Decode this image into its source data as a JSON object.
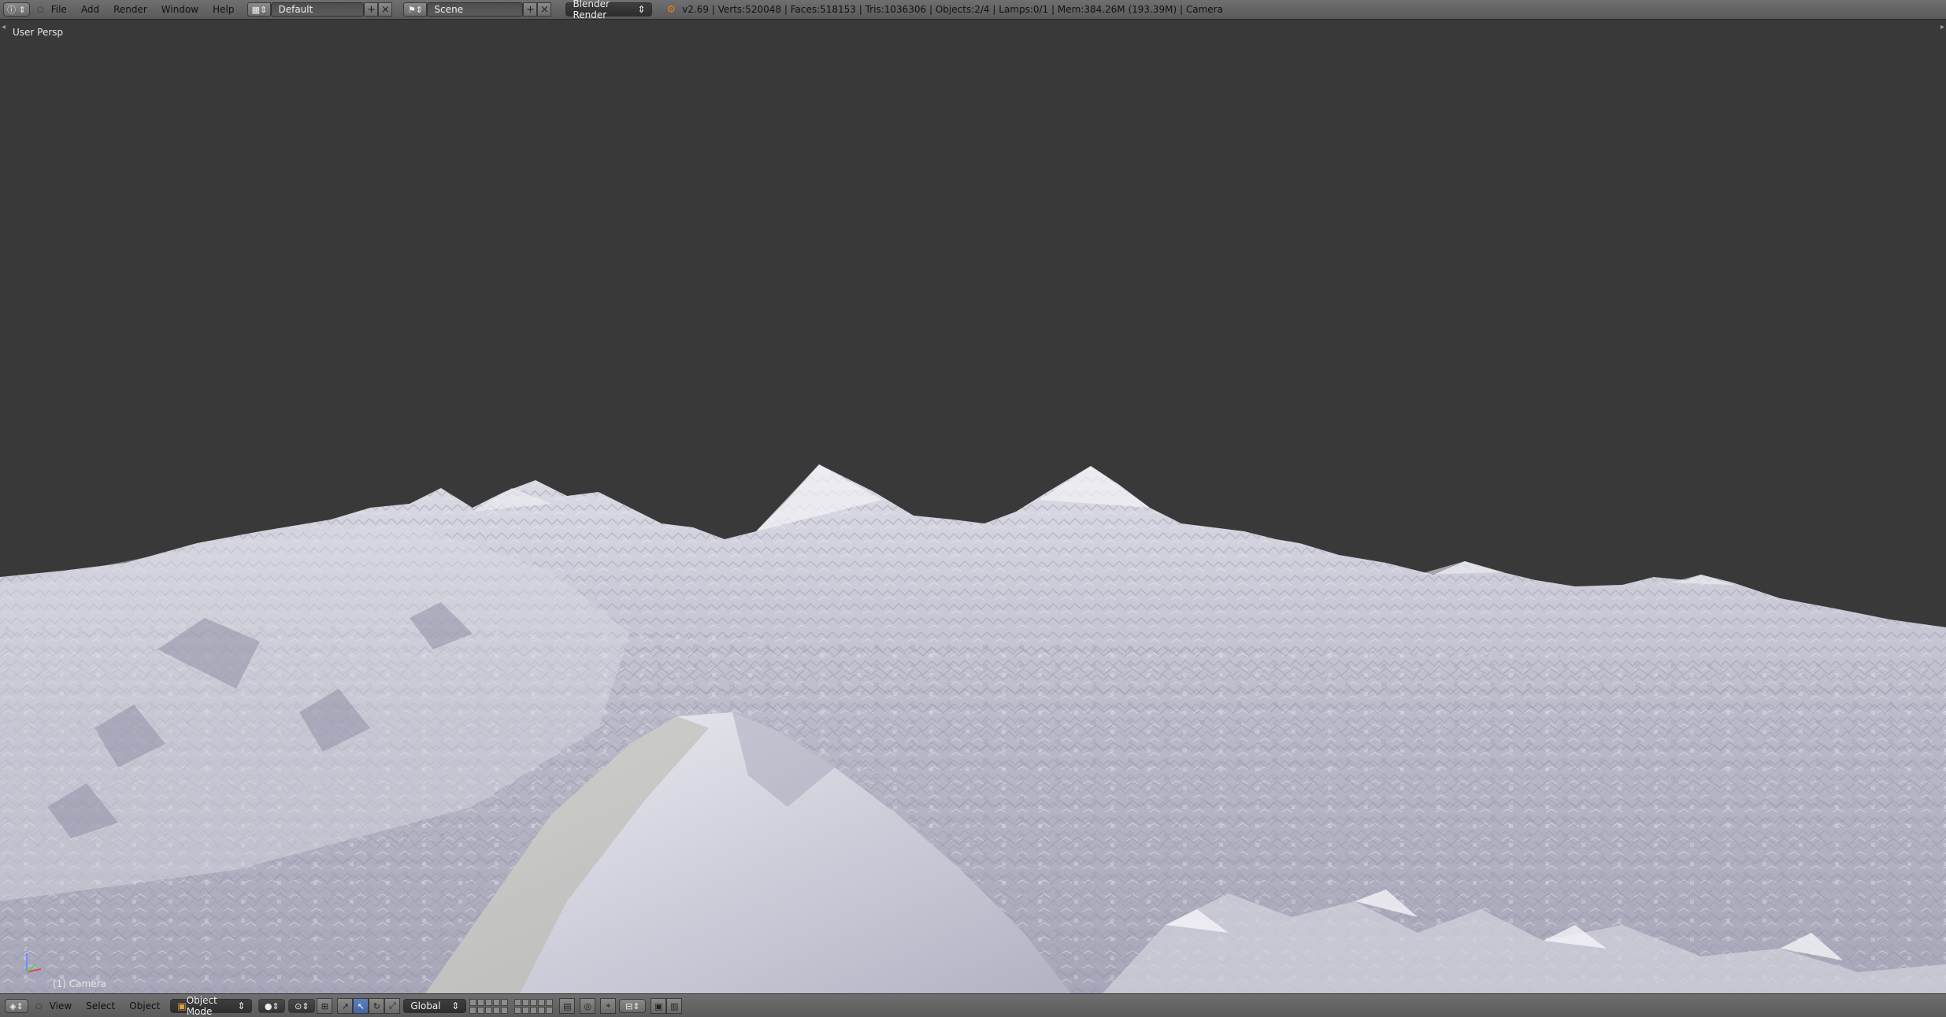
{
  "topbar": {
    "menus": [
      "File",
      "Add",
      "Render",
      "Window",
      "Help"
    ],
    "screen_layout": "Default",
    "scene": "Scene",
    "render_engine": "Blender Render",
    "stats": "v2.69 | Verts:520048 | Faces:518153 | Tris:1036306 | Objects:2/4 | Lamps:0/1 | Mem:384.26M (193.39M) | Camera"
  },
  "viewport": {
    "view_label": "User Persp",
    "object_label": "(1) Camera",
    "background_color": "#393939",
    "terrain_color": "#c9c9d6"
  },
  "bottombar": {
    "menus": [
      "View",
      "Select",
      "Object"
    ],
    "mode": "Object Mode",
    "orientation": "Global"
  },
  "icons": [
    "info-editor-icon",
    "blender-logo-icon",
    "screen-layout-icon",
    "scene-icon",
    "view3d-editor-icon",
    "object-mode-icon",
    "shading-solid-icon",
    "pivot-icon",
    "manipulator-icon",
    "axis-gizmo-icon"
  ],
  "colors": {
    "header_bg": "#646464",
    "accent": "#5b7fbf"
  }
}
